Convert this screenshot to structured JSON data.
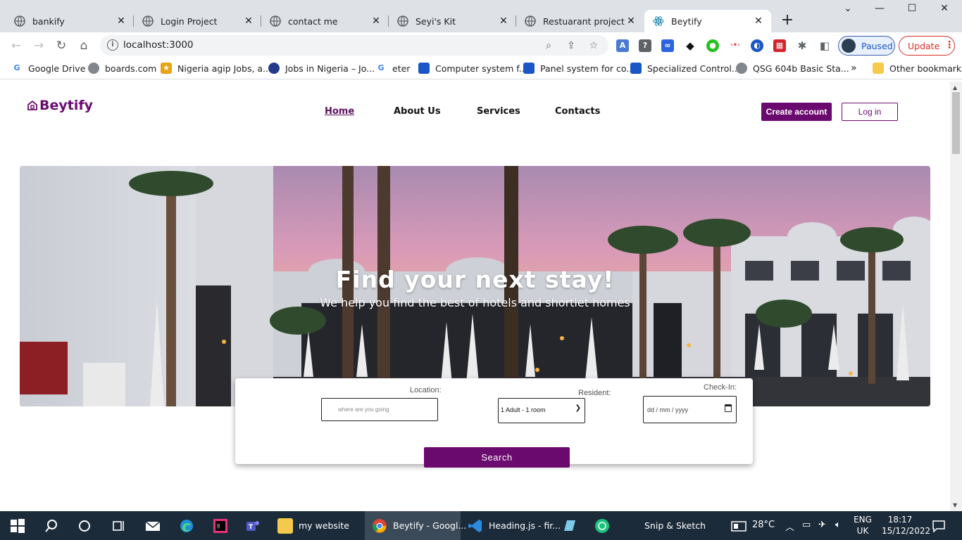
{
  "browser": {
    "tabs": [
      {
        "title": "bankify",
        "active": false
      },
      {
        "title": "Login Project",
        "active": false
      },
      {
        "title": "contact me",
        "active": false
      },
      {
        "title": "Seyi's Kit",
        "active": false
      },
      {
        "title": "Restuarant project",
        "active": false
      },
      {
        "title": "Beytify",
        "active": true
      }
    ],
    "url": "localhost:3000",
    "profile_status": "Paused",
    "update_label": "Update",
    "bookmarks": [
      {
        "label": "Google Drive",
        "icon": "google-icon"
      },
      {
        "label": "boards.com",
        "icon": "globe-icon"
      },
      {
        "label": "Nigeria agip Jobs, a...",
        "icon": "agip-icon"
      },
      {
        "label": "Jobs in Nigeria – Jo...",
        "icon": "jobs-icon"
      },
      {
        "label": "eter",
        "icon": "google-icon"
      },
      {
        "label": "Computer system f...",
        "icon": "doc-icon"
      },
      {
        "label": "Panel system for co...",
        "icon": "doc-icon"
      },
      {
        "label": "Specialized Control...",
        "icon": "doc-icon"
      },
      {
        "label": "QSG 604b Basic Sta...",
        "icon": "globe-icon"
      }
    ],
    "bookmarks_overflow": "»",
    "other_bookmarks": "Other bookmarks"
  },
  "site": {
    "brand": "Beytify",
    "nav": [
      {
        "label": "Home",
        "active": true
      },
      {
        "label": "About Us",
        "active": false
      },
      {
        "label": "Services",
        "active": false
      },
      {
        "label": "Contacts",
        "active": false
      }
    ],
    "create_account": "Create account",
    "login": "Log in",
    "hero": {
      "title": "Find your next stay!",
      "subtitle": "We help you find the best of hotels and shortlet homes"
    },
    "search": {
      "location_label": "Location:",
      "location_placeholder": "where are you going",
      "resident_label": "Resident:",
      "resident_value": "1 Adult - 1 room",
      "checkin_label": "Check-In:",
      "checkin_placeholder": "dd / mm / yyyy",
      "button": "Search"
    },
    "colors": {
      "brand": "#6a0a6f"
    }
  },
  "taskbar": {
    "apps": [
      {
        "label": "my website",
        "icon": "folder-icon"
      },
      {
        "label": "Beytify - Googl...",
        "icon": "chrome-icon",
        "active": true
      },
      {
        "label": "Heading.js - fir...",
        "icon": "vscode-icon"
      },
      {
        "label": "Snip & Sketch",
        "icon": "snip-icon"
      }
    ],
    "weather": "28°C",
    "language": "ENG",
    "region": "UK",
    "time": "18:17",
    "date": "15/12/2022"
  }
}
